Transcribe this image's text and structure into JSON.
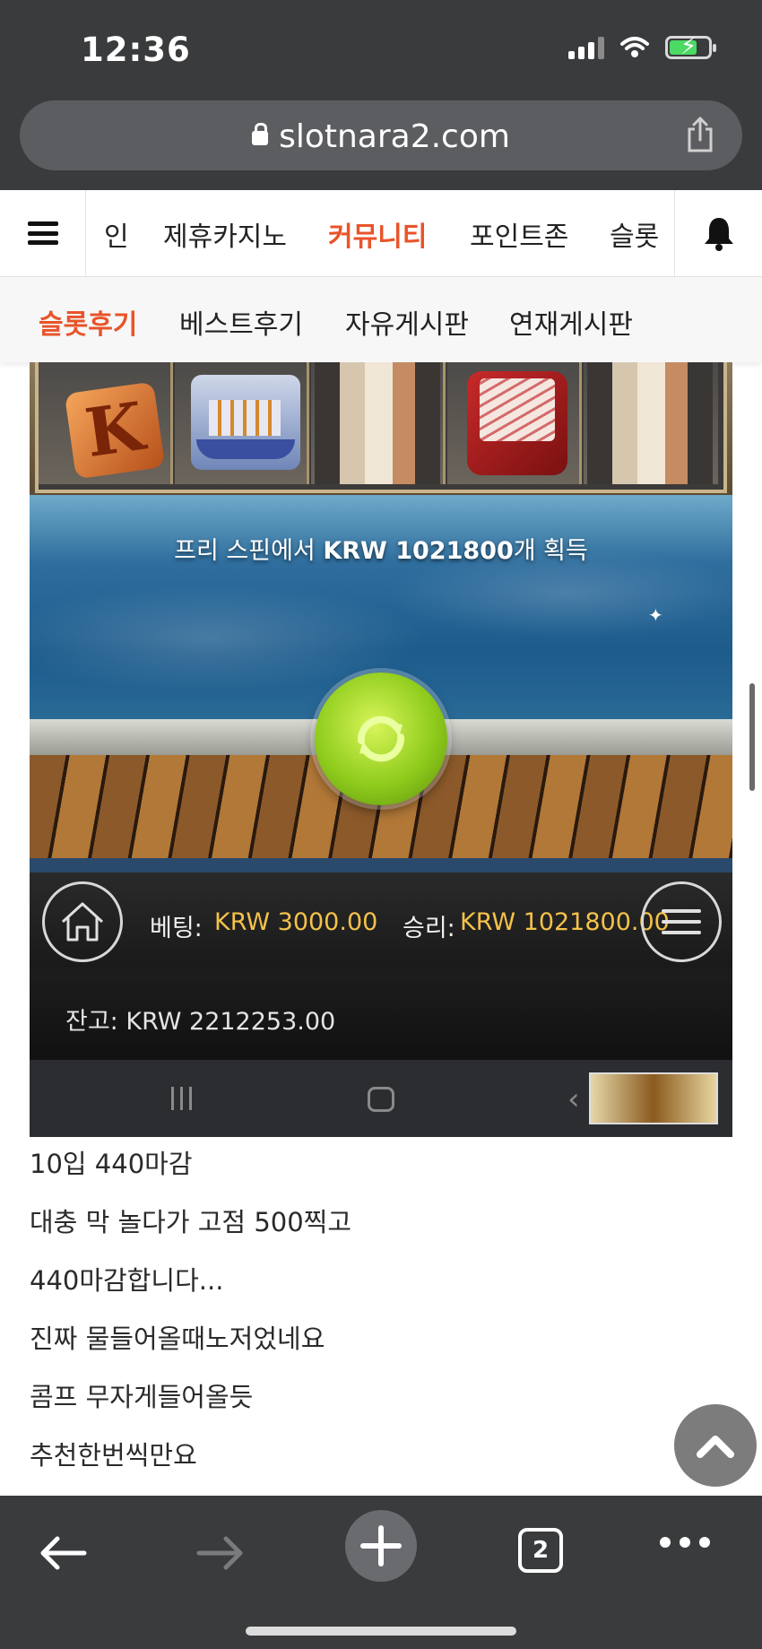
{
  "status_bar": {
    "time": "12:36"
  },
  "browser": {
    "url": "slotnara2.com",
    "tab_count": "2"
  },
  "site_nav": {
    "items": [
      "인",
      "제휴카지노",
      "커뮤니티",
      "포인트존",
      "슬롯"
    ],
    "active_index": 2
  },
  "sub_nav": {
    "items": [
      "슬롯후기",
      "베스트후기",
      "자유게시판",
      "연재게시판"
    ],
    "active_index": 0
  },
  "game": {
    "win_prefix": "프리 스핀에서 ",
    "win_amount": "KRW 1021800",
    "win_suffix": "개 획득",
    "k_symbol": "K",
    "bet_label": "베팅:",
    "bet_value": "KRW 3000.00",
    "win_label": "승리:",
    "win_value": "KRW 1021800.00",
    "balance": "잔고: KRW 2212253.00"
  },
  "post": {
    "lines": [
      "10입 440마감",
      "대충 막 놀다가 고점 500찍고",
      "440마감합니다...",
      "진짜 물들어올때노저었네요",
      "콤프 무자게들어올듯",
      "추천한번씩만요"
    ]
  },
  "colors": {
    "accent": "#e8542a",
    "chrome": "#3a3b3d",
    "game_gold": "#f4c24a",
    "spin_green": "#8fcc1c"
  }
}
